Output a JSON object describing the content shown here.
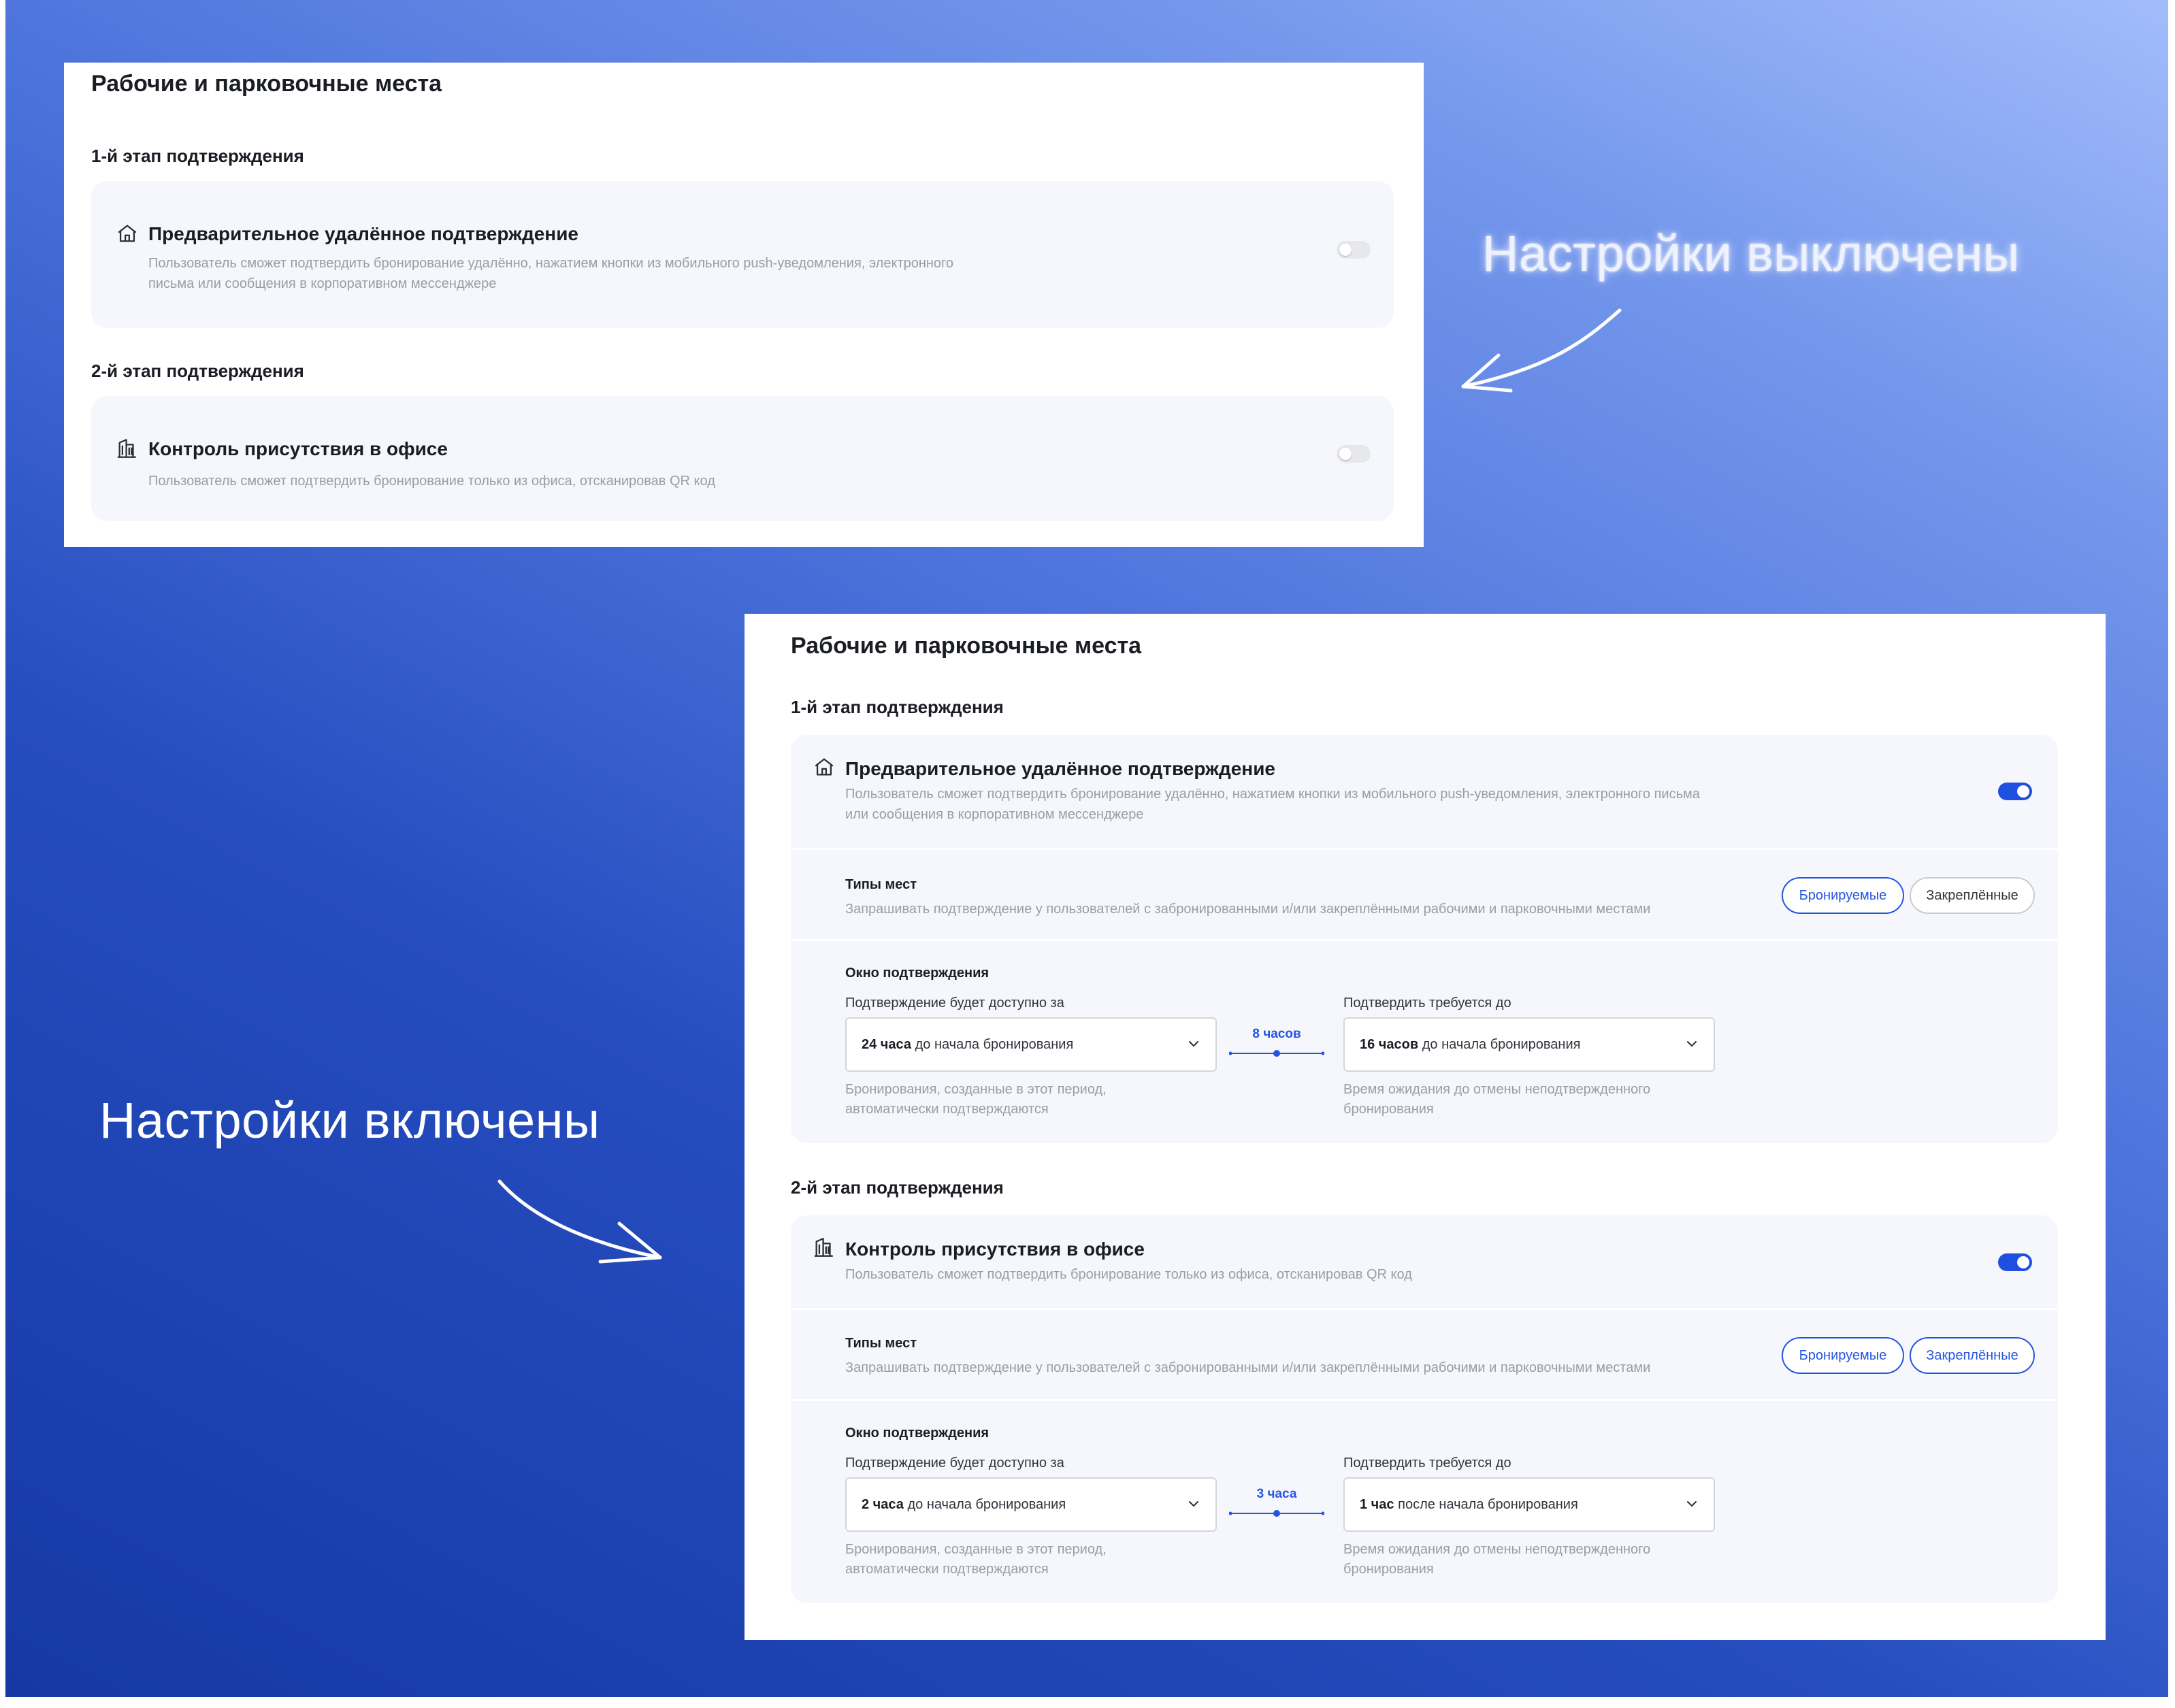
{
  "annotations": {
    "off_label": "Настройки выключены",
    "on_label": "Настройки включены"
  },
  "panel_off": {
    "title": "Рабочие и парковочные места",
    "stage1": {
      "label": "1-й этап подтверждения",
      "title": "Предварительное удалённое подтверждение",
      "desc": "Пользователь сможет подтвердить бронирование удалённо, нажатием кнопки из мобильного push-уведомления, электронного письма или сообщения в корпоративном мессенджере",
      "enabled": false
    },
    "stage2": {
      "label": "2-й этап подтверждения",
      "title": "Контроль присутствия в офисе",
      "desc": "Пользователь сможет подтвердить бронирование только из офиса, отсканировав QR код",
      "enabled": false
    }
  },
  "panel_on": {
    "title": "Рабочие и парковочные места",
    "stage1": {
      "label": "1-й этап подтверждения",
      "title": "Предварительное удалённое подтверждение",
      "desc": "Пользователь сможет подтвердить бронирование удалённо, нажатием кнопки из мобильного push-уведомления, электронного письма или сообщения в корпоративном мессенджере",
      "enabled": true,
      "types": {
        "label": "Типы мест",
        "desc": "Запрашивать подтверждение у пользователей с забронированными и/или закреплёнными рабочими и парковочными местами",
        "chip_booked": "Бронируемые",
        "chip_fixed": "Закреплённые",
        "booked_active": true,
        "fixed_active": false
      },
      "window": {
        "label": "Окно подтверждения",
        "from_label": "Подтверждение будет доступно за",
        "from_value_bold": "24 часа",
        "from_value_rest": "до начала бронирования",
        "from_hint": "Бронирования, созданные в этот период, автоматически подтверждаются",
        "gap": "8 часов",
        "to_label": "Подтвердить требуется до",
        "to_value_bold": "16 часов",
        "to_value_rest": "до начала бронирования",
        "to_hint": "Время ожидания до отмены неподтвержденного бронирования"
      }
    },
    "stage2": {
      "label": "2-й этап подтверждения",
      "title": "Контроль присутствия в офисе",
      "desc": "Пользователь сможет подтвердить бронирование только из офиса, отсканировав QR код",
      "enabled": true,
      "types": {
        "label": "Типы мест",
        "desc": "Запрашивать подтверждение у пользователей с забронированными и/или закреплёнными рабочими и парковочными местами",
        "chip_booked": "Бронируемые",
        "chip_fixed": "Закреплённые",
        "booked_active": true,
        "fixed_active": true
      },
      "window": {
        "label": "Окно подтверждения",
        "from_label": "Подтверждение будет доступно за",
        "from_value_bold": "2 часа",
        "from_value_rest": "до начала бронирования",
        "from_hint": "Бронирования, созданные в этот период, автоматически подтверждаются",
        "gap": "3 часа",
        "to_label": "Подтвердить требуется до",
        "to_value_bold": "1 час",
        "to_value_rest": "после начала бронирования",
        "to_hint": "Время ожидания до отмены неподтвержденного бронирования"
      }
    }
  },
  "icons": {
    "stage1": "home-icon",
    "stage2": "office-building-icon",
    "select": "chevron-down-icon"
  },
  "colors": {
    "accent": "#2454e4",
    "toggle_on": "#1f4fe0",
    "toggle_off": "#e7e8ec",
    "card_bg": "#f6f7fc",
    "muted_text": "#9a9da8"
  }
}
